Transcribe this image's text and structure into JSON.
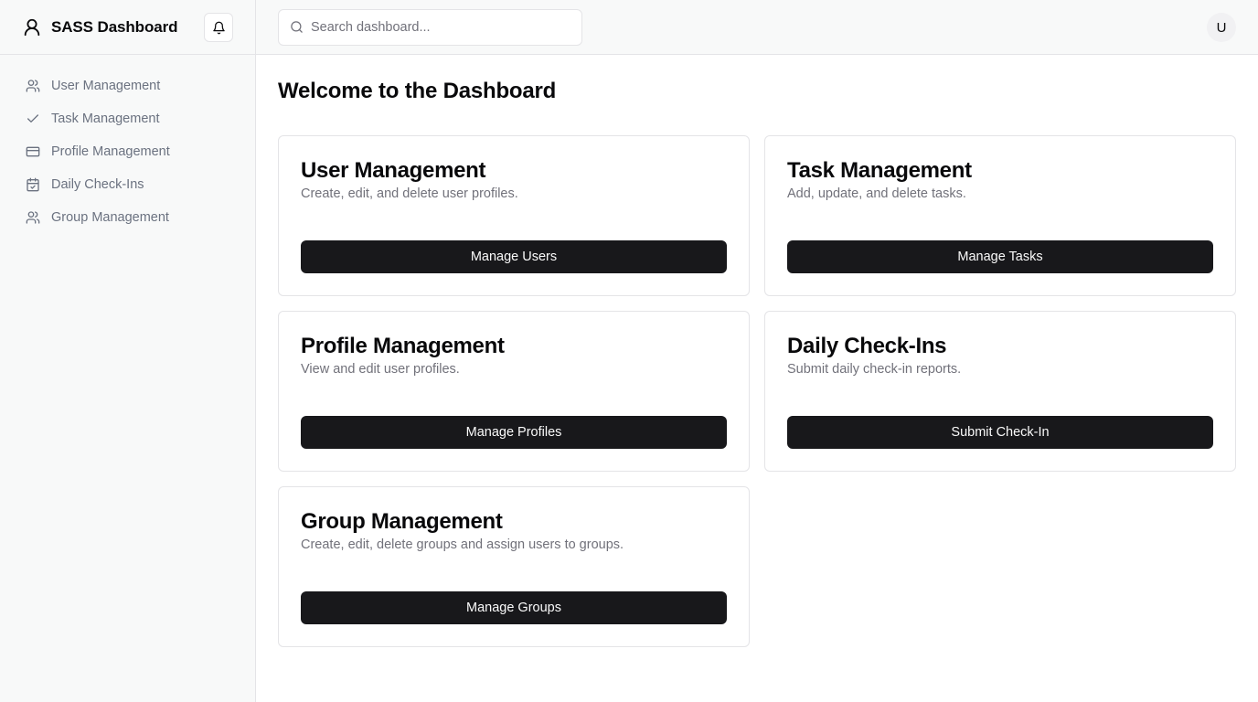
{
  "brand": {
    "title": "SASS Dashboard",
    "icon": "user-icon"
  },
  "header": {
    "bell_icon": "bell-icon",
    "search": {
      "placeholder": "Search dashboard...",
      "value": "",
      "icon": "search-icon"
    },
    "avatar": {
      "initial": "U"
    }
  },
  "sidebar": {
    "items": [
      {
        "label": "User Management",
        "icon": "users-icon"
      },
      {
        "label": "Task Management",
        "icon": "check-icon"
      },
      {
        "label": "Profile Management",
        "icon": "credit-card-icon"
      },
      {
        "label": "Daily Check-Ins",
        "icon": "calendar-check-icon"
      },
      {
        "label": "Group Management",
        "icon": "users-icon"
      }
    ]
  },
  "main": {
    "title": "Welcome to the Dashboard",
    "cards": [
      {
        "title": "User Management",
        "description": "Create, edit, and delete user profiles.",
        "button": "Manage Users"
      },
      {
        "title": "Task Management",
        "description": "Add, update, and delete tasks.",
        "button": "Manage Tasks"
      },
      {
        "title": "Profile Management",
        "description": "View and edit user profiles.",
        "button": "Manage Profiles"
      },
      {
        "title": "Daily Check-Ins",
        "description": "Submit daily check-in reports.",
        "button": "Submit Check-In"
      },
      {
        "title": "Group Management",
        "description": "Create, edit, delete groups and assign users to groups.",
        "button": "Manage Groups"
      }
    ]
  },
  "colors": {
    "button_bg": "#18181b",
    "button_text": "#fafafa",
    "muted_text": "#71717a",
    "border": "#e4e4e7",
    "sidebar_bg": "#f8f9f9"
  }
}
